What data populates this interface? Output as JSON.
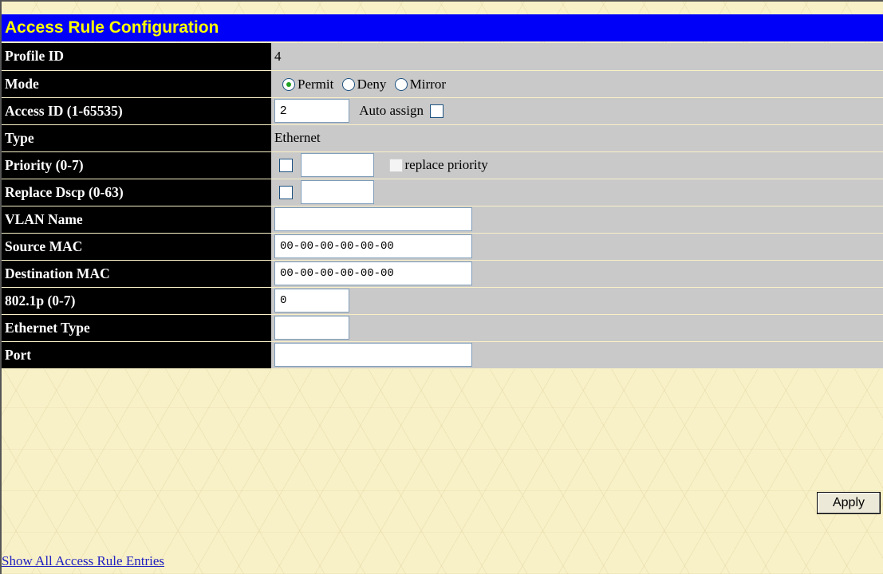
{
  "page": {
    "title": "Access Rule Configuration"
  },
  "rows": {
    "profile_id": {
      "label": "Profile ID",
      "value": "4"
    },
    "mode": {
      "label": "Mode",
      "options": [
        "Permit",
        "Deny",
        "Mirror"
      ],
      "selected": "Permit"
    },
    "access_id": {
      "label": "Access ID (1-65535)",
      "value": "2",
      "auto_assign_label": "Auto assign",
      "auto_assign_checked": false
    },
    "type": {
      "label": "Type",
      "value": "Ethernet"
    },
    "priority": {
      "label": "Priority (0-7)",
      "value": "",
      "replace_label": "replace priority",
      "checked": false
    },
    "replace_dscp": {
      "label": "Replace Dscp (0-63)",
      "value": "",
      "checked": false
    },
    "vlan_name": {
      "label": "VLAN Name",
      "value": ""
    },
    "source_mac": {
      "label": "Source MAC",
      "value": "00-00-00-00-00-00"
    },
    "destination_mac": {
      "label": "Destination MAC",
      "value": "00-00-00-00-00-00"
    },
    "dot1p": {
      "label": "802.1p (0-7)",
      "value": "0"
    },
    "ethernet_type": {
      "label": "Ethernet Type",
      "value": ""
    },
    "port": {
      "label": "Port",
      "value": ""
    }
  },
  "actions": {
    "apply_label": "Apply",
    "show_all_label": "Show All Access Rule Entries"
  },
  "colors": {
    "title_bg": "#0000f8",
    "title_fg": "#ffff00",
    "label_bg": "#000000",
    "value_bg": "#c9c9c9",
    "page_bg": "#f8f1c8",
    "radio_dot": "#21a121",
    "link": "#2020c0"
  }
}
